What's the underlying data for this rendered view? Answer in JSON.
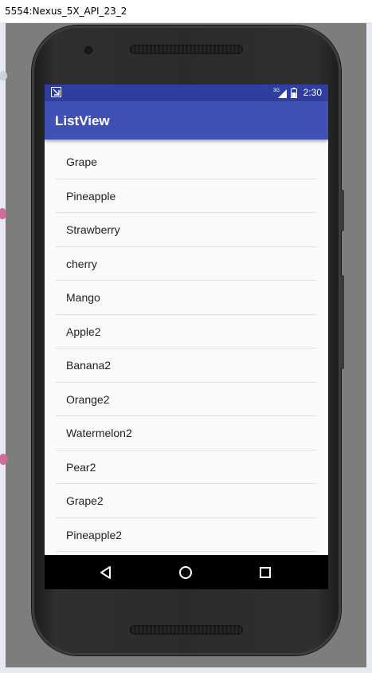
{
  "window": {
    "title": "5554:Nexus_5X_API_23_2"
  },
  "status_bar": {
    "time": "2:30",
    "network_label": "3G"
  },
  "app_bar": {
    "title": "ListView"
  },
  "list": {
    "items": [
      "Grape",
      "Pineapple",
      "Strawberry",
      "cherry",
      "Mango",
      "Apple2",
      "Banana2",
      "Orange2",
      "Watermelon2",
      "Pear2",
      "Grape2",
      "Pineapple2"
    ]
  },
  "nav_bar": {
    "buttons": [
      "back-icon",
      "home-icon",
      "recents-icon"
    ]
  },
  "colors": {
    "status_bar": "#303f9f",
    "app_bar": "#3f51b5",
    "list_background": "#fafafa",
    "divider": "#e0e0e0",
    "nav_bar": "#000000"
  }
}
